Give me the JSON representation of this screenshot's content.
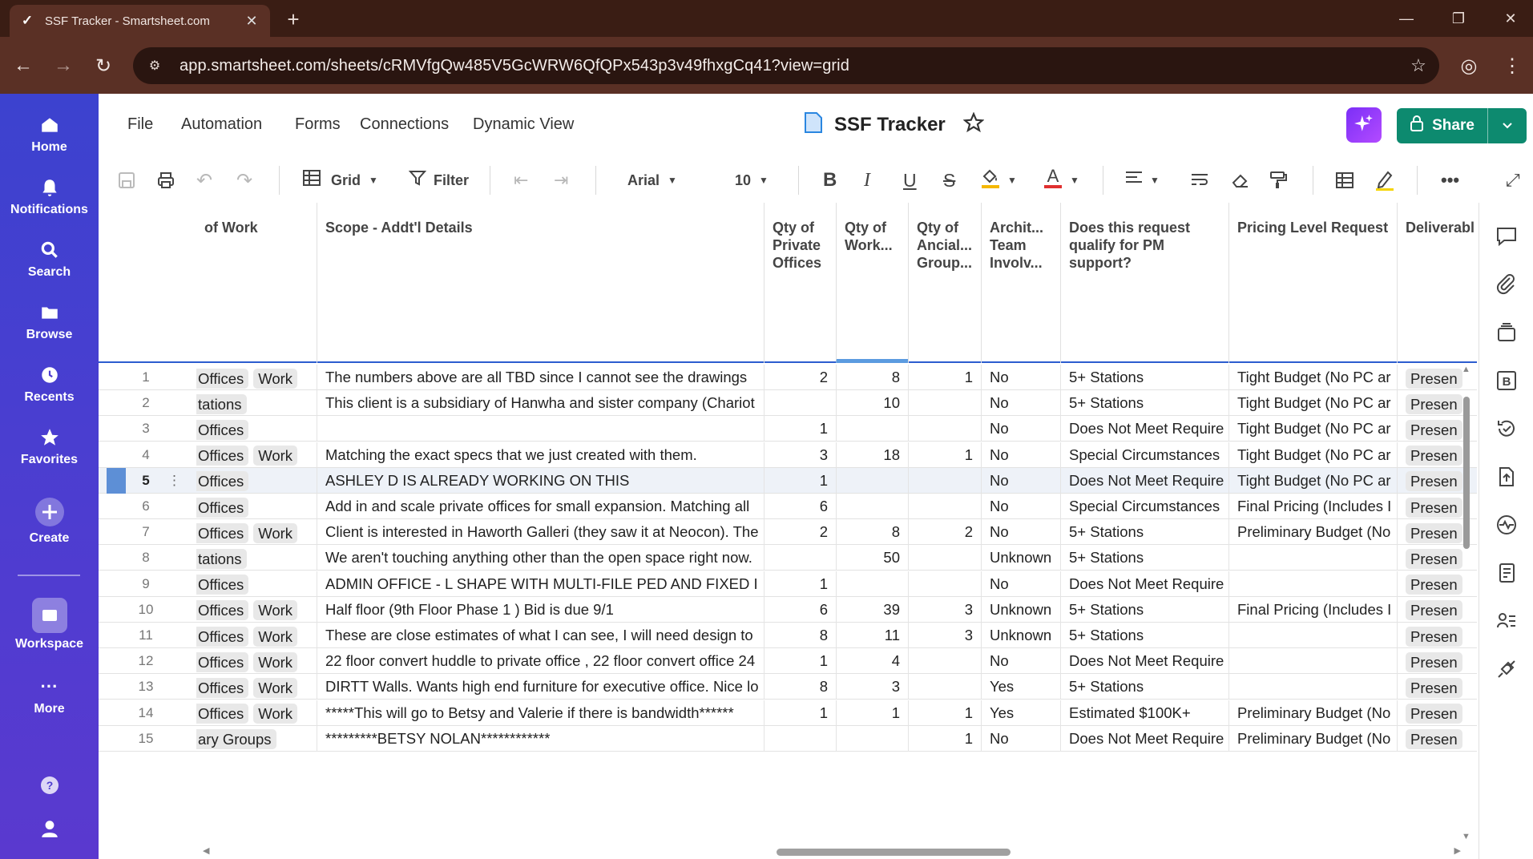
{
  "browser": {
    "tab_title": "SSF Tracker - Smartsheet.com",
    "url": "app.smartsheet.com/sheets/cRMVfgQw485V5GcWRW6QfQPx543p3v49fhxgCq41?view=grid"
  },
  "rail": {
    "items": [
      {
        "label": "Home",
        "icon": "home-icon"
      },
      {
        "label": "Notifications",
        "icon": "bell-icon"
      },
      {
        "label": "Search",
        "icon": "search-icon"
      },
      {
        "label": "Browse",
        "icon": "folder-icon"
      },
      {
        "label": "Recents",
        "icon": "clock-icon"
      },
      {
        "label": "Favorites",
        "icon": "star-icon"
      },
      {
        "label": "Create",
        "icon": "plus-icon"
      },
      {
        "label": "Workspace",
        "icon": "workspace-icon"
      },
      {
        "label": "More",
        "icon": "more-icon"
      }
    ]
  },
  "menu": {
    "file": "File",
    "automation": "Automation",
    "forms": "Forms",
    "connections": "Connections",
    "dynamic_view": "Dynamic View"
  },
  "sheet": {
    "title": "SSF Tracker"
  },
  "share": {
    "label": "Share"
  },
  "toolbar": {
    "view_label": "Grid",
    "filter_label": "Filter",
    "font_name": "Arial",
    "font_size": "10",
    "colors": {
      "fill": "#f5b800",
      "text": "#e03030"
    }
  },
  "columns": {
    "type_of_work": "of Work",
    "scope": "Scope - Addt'l Details",
    "qty_private": "Qty of Private Offices",
    "qty_work": "Qty of Work...",
    "qty_ancillary": "Qty of Ancial... Group...",
    "arch_team": "Archit... Team Involv...",
    "pm_support": "Does this request qualify for PM support?",
    "pricing_level": "Pricing Level Request",
    "deliverable": "Deliverabl"
  },
  "rows": [
    {
      "n": "1",
      "type": [
        " Offices",
        "Work"
      ],
      "scope": "The numbers above are all TBD since I cannot see the drawings",
      "qp": "2",
      "qw": "8",
      "qa": "1",
      "arch": "No",
      "pm": "5+ Stations",
      "price": "Tight Budget (No PC ar",
      "deliv": "Presen"
    },
    {
      "n": "2",
      "type": [
        "tations"
      ],
      "scope": "This client is a subsidiary of Hanwha and sister company (Chariot",
      "qp": "",
      "qw": "10",
      "qa": "",
      "arch": "No",
      "pm": "5+ Stations",
      "price": "Tight Budget (No PC ar",
      "deliv": "Presen"
    },
    {
      "n": "3",
      "type": [
        " Offices"
      ],
      "scope": "",
      "qp": "1",
      "qw": "",
      "qa": "",
      "arch": "No",
      "pm": "Does Not Meet Require",
      "price": "Tight Budget (No PC ar",
      "deliv": "Presen"
    },
    {
      "n": "4",
      "type": [
        " Offices",
        "Work"
      ],
      "scope": "Matching the exact specs that we just created with them.",
      "qp": "3",
      "qw": "18",
      "qa": "1",
      "arch": "No",
      "pm": "Special Circumstances",
      "price": "Tight Budget (No PC ar",
      "deliv": "Presen"
    },
    {
      "n": "5",
      "type": [
        " Offices"
      ],
      "scope": "ASHLEY D IS ALREADY WORKING ON THIS",
      "qp": "1",
      "qw": "",
      "qa": "",
      "arch": "No",
      "pm": "Does Not Meet Require",
      "price": "Tight Budget (No PC ar",
      "deliv": "Presen"
    },
    {
      "n": "6",
      "type": [
        " Offices"
      ],
      "scope": "Add in and scale private offices for small expansion. Matching all",
      "qp": "6",
      "qw": "",
      "qa": "",
      "arch": "No",
      "pm": "Special Circumstances",
      "price": "Final Pricing (Includes I",
      "deliv": "Presen"
    },
    {
      "n": "7",
      "type": [
        " Offices",
        "Work"
      ],
      "scope": "Client is interested in Haworth Galleri (they saw it at Neocon). The",
      "qp": "2",
      "qw": "8",
      "qa": "2",
      "arch": "No",
      "pm": "5+ Stations",
      "price": "Preliminary Budget (No",
      "deliv": "Presen"
    },
    {
      "n": "8",
      "type": [
        "tations"
      ],
      "scope": "We aren't touching anything other than the open space right now.",
      "qp": "",
      "qw": "50",
      "qa": "",
      "arch": "Unknown",
      "pm": "5+ Stations",
      "price": "",
      "deliv": "Presen"
    },
    {
      "n": "9",
      "type": [
        " Offices"
      ],
      "scope": "ADMIN OFFICE - L SHAPE WITH MULTI-FILE PED AND FIXED I",
      "qp": "1",
      "qw": "",
      "qa": "",
      "arch": "No",
      "pm": "Does Not Meet Require",
      "price": "",
      "deliv": "Presen"
    },
    {
      "n": "10",
      "type": [
        " Offices",
        "Work"
      ],
      "scope": "Half floor (9th Floor Phase 1 ) Bid is due 9/1",
      "qp": "6",
      "qw": "39",
      "qa": "3",
      "arch": "Unknown",
      "pm": "5+ Stations",
      "price": "Final Pricing (Includes I",
      "deliv": "Presen"
    },
    {
      "n": "11",
      "type": [
        " Offices",
        "Work"
      ],
      "scope": "These are close estimates of what I can see, I will need design to",
      "qp": "8",
      "qw": "11",
      "qa": "3",
      "arch": "Unknown",
      "pm": "5+ Stations",
      "price": "",
      "deliv": "Presen"
    },
    {
      "n": "12",
      "type": [
        " Offices",
        "Work"
      ],
      "scope": "22 floor convert huddle to private office , 22 floor convert office 24",
      "qp": "1",
      "qw": "4",
      "qa": "",
      "arch": "No",
      "pm": "Does Not Meet Require",
      "price": "",
      "deliv": "Presen"
    },
    {
      "n": "13",
      "type": [
        " Offices",
        "Work"
      ],
      "scope": "DIRTT Walls. Wants high end furniture for executive office. Nice lo",
      "qp": "8",
      "qw": "3",
      "qa": "",
      "arch": "Yes",
      "pm": "5+ Stations",
      "price": "",
      "deliv": "Presen"
    },
    {
      "n": "14",
      "type": [
        " Offices",
        "Work"
      ],
      "scope": "*****This will go to Betsy and Valerie if there is bandwidth******",
      "qp": "1",
      "qw": "1",
      "qa": "1",
      "arch": "Yes",
      "pm": "Estimated $100K+",
      "price": "Preliminary Budget (No",
      "deliv": "Presen"
    },
    {
      "n": "15",
      "type": [
        "ary Groups"
      ],
      "scope": "*********BETSY NOLAN************",
      "qp": "",
      "qw": "",
      "qa": "1",
      "arch": "No",
      "pm": "Does Not Meet Require",
      "price": "Preliminary Budget (No",
      "deliv": "Presen"
    }
  ]
}
